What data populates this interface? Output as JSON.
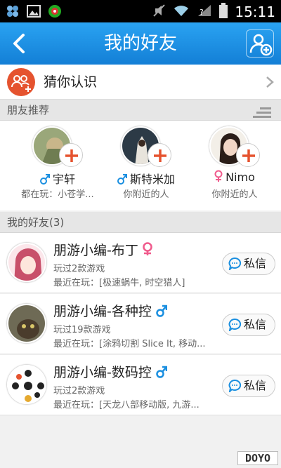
{
  "statusbar": {
    "time": "15:11"
  },
  "header": {
    "title": "我的好友"
  },
  "guess": {
    "label": "猜你认识"
  },
  "sections": {
    "recommend": "朋友推荐",
    "friends": "我的好友(3)"
  },
  "recommendations": [
    {
      "name": "宇轩",
      "gender": "male",
      "sub": "都在玩：小苍学..."
    },
    {
      "name": "斯特米加",
      "gender": "male",
      "sub": "你附近的人"
    },
    {
      "name": "Nimo",
      "gender": "female",
      "sub": "你附近的人"
    }
  ],
  "friends": [
    {
      "name": "朋游小编-布丁",
      "gender": "female",
      "games": "玩过2款游戏",
      "recent": "最近在玩：[极速蜗牛, 时空猎人]",
      "pm": "私信"
    },
    {
      "name": "朋游小编-各种控",
      "gender": "male",
      "games": "玩过19款游戏",
      "recent": "最近在玩：[涂鸦切割 Slice It, 移动...",
      "pm": "私信"
    },
    {
      "name": "朋游小编-数码控",
      "gender": "male",
      "games": "玩过2款游戏",
      "recent": "最近在玩：[天龙八部移动版, 九游...",
      "pm": "私信"
    }
  ],
  "watermark": "DOYO",
  "colors": {
    "header": "#1a8fe0",
    "male": "#1a8fe0",
    "female": "#f05a8c",
    "accent": "#e5532f"
  }
}
